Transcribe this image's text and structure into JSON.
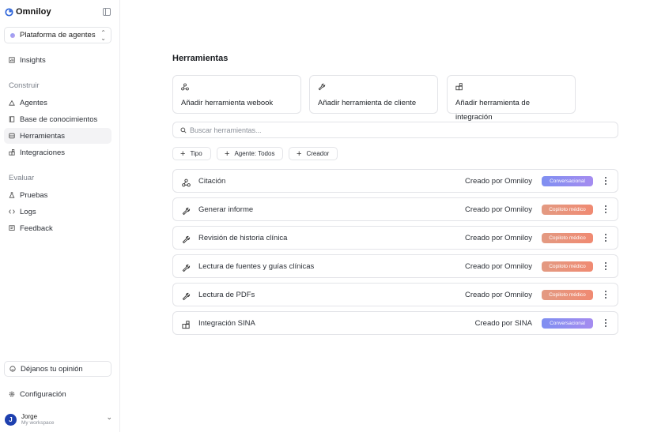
{
  "brand": {
    "name": "Omniloy"
  },
  "workspace": {
    "label": "Plataforma de agentes"
  },
  "nav": {
    "insights": "Insights",
    "build_section": "Construir",
    "build_items": [
      "Agentes",
      "Base de conocimientos",
      "Herramientas",
      "Integraciones"
    ],
    "evaluate_section": "Evaluar",
    "evaluate_items": [
      "Pruebas",
      "Logs",
      "Feedback"
    ],
    "active": "Herramientas"
  },
  "footer": {
    "feedback": "Déjanos tu opinión",
    "settings": "Configuración",
    "user": {
      "initial": "J",
      "name": "Jorge",
      "workspace": "My workspace"
    }
  },
  "main": {
    "title": "Herramientas",
    "add_cards": [
      {
        "label": "Añadir herramienta webook",
        "icon": "webhook-icon"
      },
      {
        "label": "Añadir herramienta de cliente",
        "icon": "wrench-icon"
      },
      {
        "label": "Añadir herramienta de integración",
        "icon": "integration-blocks-icon"
      }
    ],
    "search": {
      "placeholder": "Buscar herramientas..."
    },
    "filters": [
      "Tipo",
      "Agente: Todos",
      "Creador"
    ],
    "tools": [
      {
        "name": "Citación",
        "creator": "Creado por Omniloy",
        "badge": "Conversacional",
        "badge_type": "conversational",
        "icon": "webhook-icon"
      },
      {
        "name": "Generar informe",
        "creator": "Creado por Omniloy",
        "badge": "Copiloto médico",
        "badge_type": "copilot",
        "icon": "wrench-icon"
      },
      {
        "name": "Revisión de historia clínica",
        "creator": "Creado por Omniloy",
        "badge": "Copiloto médico",
        "badge_type": "copilot",
        "icon": "wrench-icon"
      },
      {
        "name": "Lectura de fuentes y guías clínicas",
        "creator": "Creado por Omniloy",
        "badge": "Copiloto médico",
        "badge_type": "copilot",
        "icon": "wrench-icon"
      },
      {
        "name": "Lectura de PDFs",
        "creator": "Creado por Omniloy",
        "badge": "Copiloto médico",
        "badge_type": "copilot",
        "icon": "wrench-icon"
      },
      {
        "name": "Integración SINA",
        "creator": "Creado por SINA",
        "badge": "Conversacional",
        "badge_type": "conversational",
        "icon": "integration-blocks-icon"
      }
    ]
  },
  "colors": {
    "conversational_from": "#7f8ff1",
    "conversational_to": "#a58cf0",
    "copilot_from": "#e39a82",
    "copilot_to": "#f08a72",
    "avatar": "#1e40af",
    "brand_icon": "#2c63d9"
  }
}
